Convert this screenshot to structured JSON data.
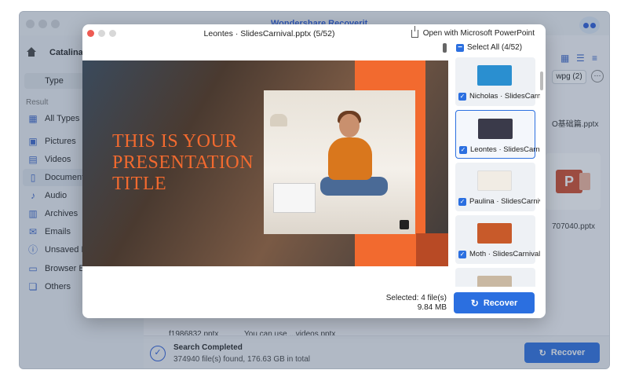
{
  "app": {
    "title": "Wondershare Recoverit",
    "drive_name": "Catalina -",
    "type_button": "Type",
    "result_label": "Result",
    "sidebar_items": [
      {
        "icon": "grid-icon",
        "label": "All Types"
      },
      {
        "icon": "picture-icon",
        "label": "Pictures"
      },
      {
        "icon": "video-icon",
        "label": "Videos"
      },
      {
        "icon": "document-icon",
        "label": "Documents"
      },
      {
        "icon": "audio-icon",
        "label": "Audio"
      },
      {
        "icon": "archive-icon",
        "label": "Archives"
      },
      {
        "icon": "email-icon",
        "label": "Emails"
      },
      {
        "icon": "unsaved-icon",
        "label": "Unsaved Files"
      },
      {
        "icon": "browser-icon",
        "label": "Browser Bookmarks"
      },
      {
        "icon": "others-icon",
        "label": "Others"
      }
    ],
    "filter_pill": "wpg (2)",
    "more_label": "···",
    "bg_files": [
      "O基础篇.pptx",
      "707040.pptx",
      "f1986832.pptx",
      "You can use ...videos.pptx"
    ],
    "status": {
      "title": "Search Completed",
      "subtitle": "374940 file(s) found, 176.63 GB in total"
    },
    "recover_label": "Recover"
  },
  "dialog": {
    "title": "Leontes · SlidesCarnival.pptx (5/52)",
    "open_with": "Open with Microsoft PowerPoint",
    "select_all": "Select All (4/52)",
    "slide_title": "THIS IS YOUR PRESENTATION TITLE",
    "thumbnails": [
      {
        "label": "Nicholas · SlidesCarnival.pptx",
        "checked": true,
        "color": "#2a8fd0"
      },
      {
        "label": "Leontes · SlidesCarnival.pptx",
        "checked": true,
        "color": "#3a3a4a",
        "selected": true
      },
      {
        "label": "Paulina · SlidesCarnival.pptx",
        "checked": true,
        "color": "#f1ece4"
      },
      {
        "label": "Moth · SlidesCarnival.pptx",
        "checked": true,
        "color": "#c85a2a"
      }
    ],
    "selected_count": "Selected: 4 file(s)",
    "selected_size": "9.84 MB",
    "recover_label": "Recover"
  },
  "colors": {
    "accent": "#2b6fe0",
    "slide_orange": "#f26a2f"
  }
}
